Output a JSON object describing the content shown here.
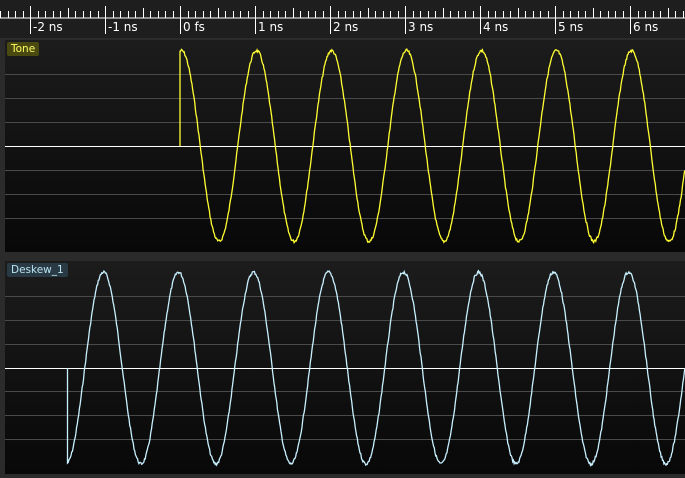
{
  "ruler": {
    "ticks": [
      "-2 ns",
      "-1 ns",
      "0 fs",
      "1 ns",
      "2 ns",
      "3 ns",
      "4 ns",
      "5 ns",
      "6 ns"
    ]
  },
  "channels": [
    {
      "name": "Tone",
      "color": "#ffff33",
      "label_bg": "#4a4a10",
      "label_fg": "#ffff66",
      "signal_start_ns": 0.0,
      "frequency_ghz": 1.0,
      "phase_offset_ns": -0.23
    },
    {
      "name": "Deskew_1",
      "color": "#c8f0ff",
      "label_bg": "#2a3a45",
      "label_fg": "#b8e4f0",
      "signal_start_ns": -1.5,
      "frequency_ghz": 1.0,
      "phase_offset_ns": -1.27
    }
  ],
  "colors": {
    "background": "#2b2b2b",
    "ruler_bg": "#1e1e1e",
    "gridline": "#4a4a4a",
    "zero_line": "#ffffff"
  }
}
